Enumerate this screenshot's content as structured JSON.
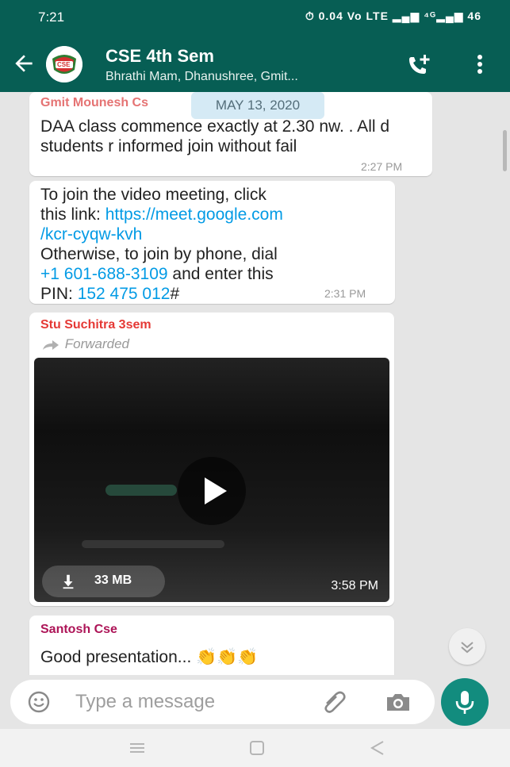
{
  "status_bar": {
    "time": "7:21",
    "sys_text": "⏱ 0.04 Vo LTE ▂▄▆ ⁴ᴳ▂▄▆ 46"
  },
  "app_bar": {
    "title": "CSE 4th Sem",
    "subtitle": "Bhrathi Mam, Dhanushree, Gmit...",
    "avatar_text": "CSE"
  },
  "date_chip": "MAY 13, 2020",
  "messages": [
    {
      "sender": "Gmit Mounesh Cs",
      "sender_color": "#e57373",
      "text": "DAA class commence exactly at 2.30 nw. . All d students r informed join without fail",
      "time": "2:27 PM"
    },
    {
      "line1": "To join the video meeting, click",
      "line2_prefix": "this link: ",
      "link1a": "https://meet.google.com",
      "link1b": "/kcr-cyqw-kvh",
      "line4": "Otherwise, to join by phone, dial",
      "phone": "+1 601-688-3109",
      "phone_suffix": " and enter this",
      "pin_prefix": "PIN: ",
      "pin": "152 475 012",
      "pin_suffix": "#",
      "time": "2:31 PM"
    },
    {
      "sender": "Stu Suchitra 3sem",
      "sender_color": "#e53935",
      "forwarded": "Forwarded",
      "size": "33 MB",
      "time": "3:58 PM"
    },
    {
      "sender": "Santosh Cse",
      "sender_color": "#ad1457",
      "text": "Good presentation... 👏👏👏"
    }
  ],
  "input": {
    "placeholder": "Type a message"
  },
  "icons": [
    "back-arrow-icon",
    "group-avatar",
    "add-call-icon",
    "more-vert-icon",
    "play-icon",
    "download-icon",
    "chevrons-down-icon",
    "emoji-icon",
    "attach-icon",
    "camera-icon",
    "mic-icon",
    "nav-menu-icon",
    "nav-home-icon",
    "nav-back-icon"
  ],
  "colors": {
    "primary": "#075e54",
    "accent": "#128c7e",
    "link": "#039be5",
    "chat_bg": "#e5e5e5"
  }
}
